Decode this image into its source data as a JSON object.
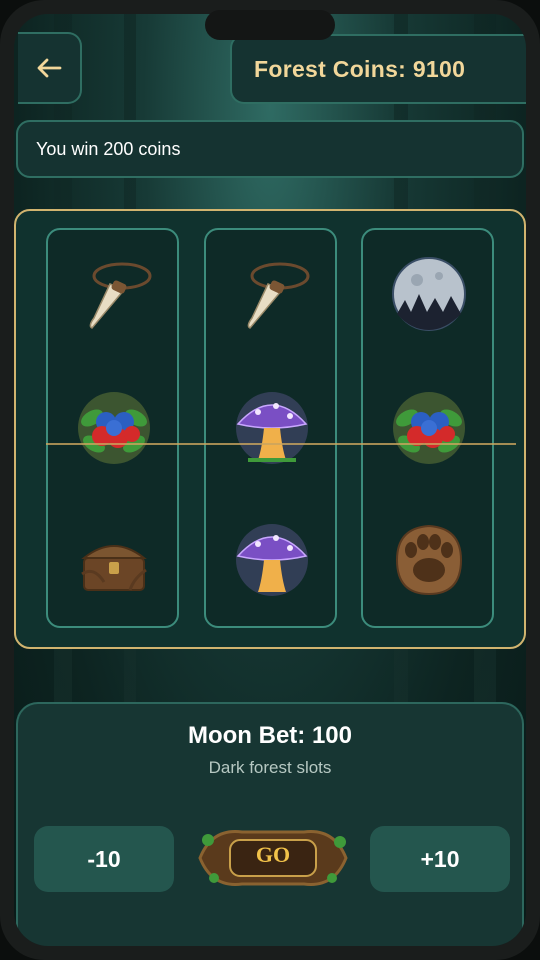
{
  "header": {
    "back_icon": "arrow-left-icon",
    "coins_label": "Forest Coins: 9100"
  },
  "message": "You win 200 coins",
  "reels": [
    [
      "fang-necklace",
      "berry-bush",
      "treasure-chest"
    ],
    [
      "fang-necklace",
      "glowing-mushroom",
      "glowing-mushroom"
    ],
    [
      "full-moon",
      "berry-bush",
      "paw-print"
    ]
  ],
  "bet": {
    "title": "Moon Bet: 100",
    "subtitle": "Dark forest slots",
    "minus_label": "-10",
    "plus_label": "+10",
    "go_label": "GO"
  },
  "colors": {
    "gold": "#f1d79a",
    "panel": "#153331",
    "border": "#2f6e62",
    "frame": "#d1b46f"
  }
}
